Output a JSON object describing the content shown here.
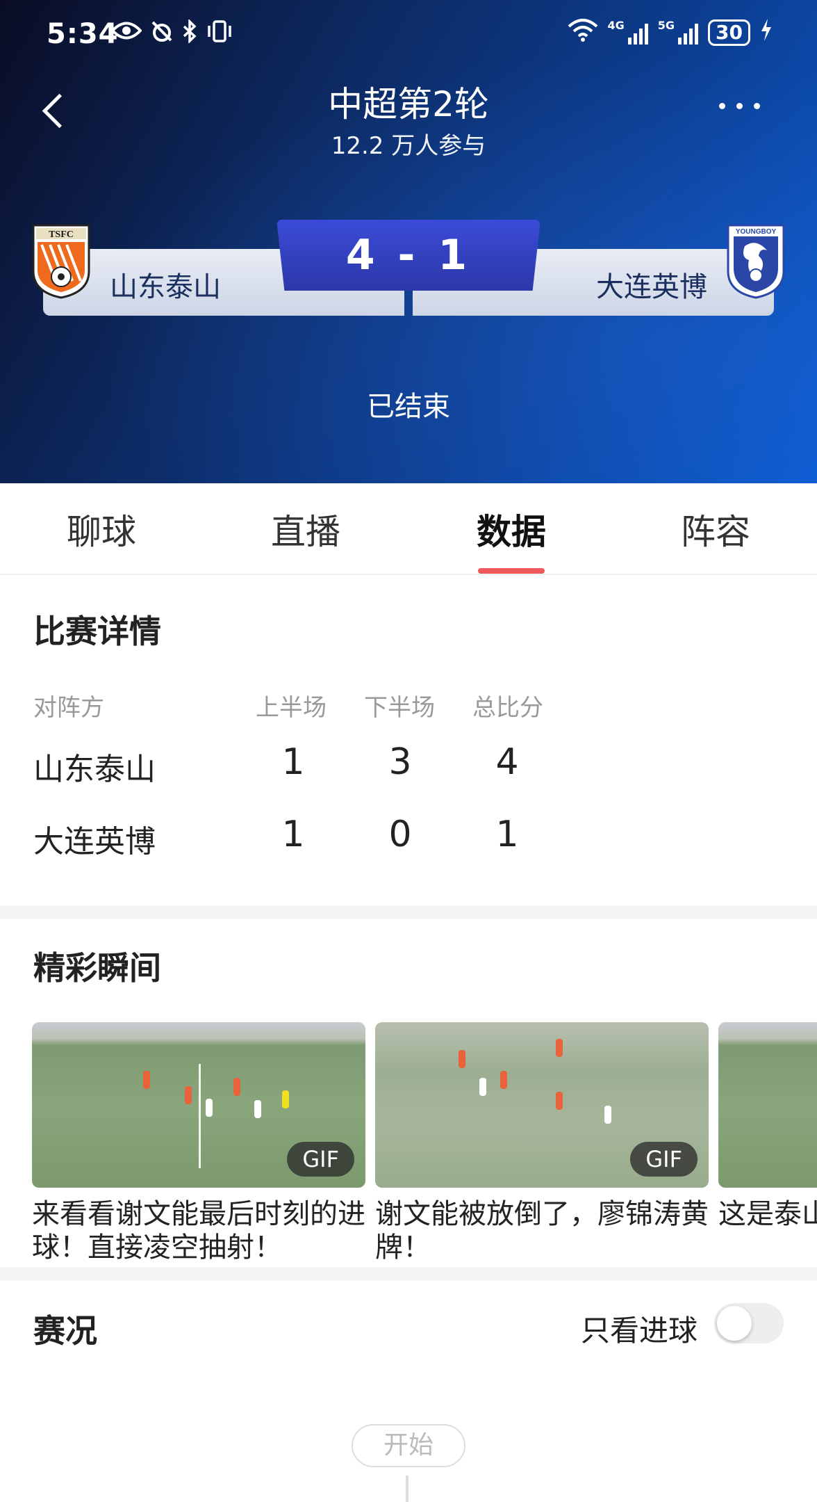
{
  "status_bar": {
    "time": "5:34",
    "battery": "30",
    "net1": "4G",
    "net2": "5G"
  },
  "header": {
    "title": "中超第2轮",
    "participants": "12.2 万人参与"
  },
  "match": {
    "home_team": "山东泰山",
    "away_team": "大连英博",
    "score": "4 - 1",
    "state": "已结束",
    "home_crest_text": "TSFC",
    "away_crest_text": "YOUNGBOY"
  },
  "tabs": [
    {
      "label": "聊球"
    },
    {
      "label": "直播"
    },
    {
      "label": "数据"
    },
    {
      "label": "阵容"
    }
  ],
  "details": {
    "title": "比赛详情",
    "headers": [
      "对阵方",
      "上半场",
      "下半场",
      "总比分"
    ],
    "rows": [
      {
        "team": "山东泰山",
        "h1": "1",
        "h2": "3",
        "total": "4"
      },
      {
        "team": "大连英博",
        "h1": "1",
        "h2": "0",
        "total": "1"
      }
    ]
  },
  "highlights": {
    "title": "精彩瞬间",
    "items": [
      {
        "caption": "来看看谢文能最后时刻的进球！直接凌空抽射！",
        "badge": "GIF"
      },
      {
        "caption": "谢文能被放倒了，廖锦涛黄牌！",
        "badge": "GIF"
      },
      {
        "caption": "这是泰山到了左侧",
        "badge": ""
      }
    ]
  },
  "live": {
    "title": "赛况",
    "goals_only_label": "只看进球",
    "goals_only_on": false,
    "start_label": "开始"
  },
  "colors": {
    "accent": "#f05a5a",
    "score_box": "#3b4bd8",
    "header_dark": "#0d2a63"
  }
}
